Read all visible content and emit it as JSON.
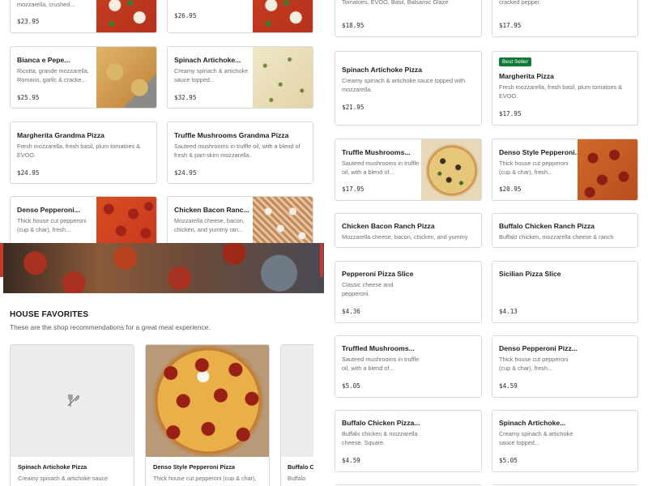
{
  "left_grid": [
    {
      "title": "",
      "desc": "mozzarella, crushed...",
      "price": "$23.95",
      "image": "pz-margherita"
    },
    {
      "title": "",
      "desc": "",
      "price": "$26.95",
      "image": "pz-margherita"
    },
    {
      "title": "Bianca e Pepe...",
      "desc": "Ricotta, grande mozzarella, Romano, garlic & cracke...",
      "price": "$25.95",
      "image": "pz-grandma"
    },
    {
      "title": "Spinach Artichoke...",
      "desc": "Creamy spinach & artichoke sauce topped...",
      "price": "$32.95",
      "image": "pz-white"
    },
    {
      "title": "Margherita Grandma Pizza",
      "desc": "Fresh mozzarella, fresh basil, plum tomatoes & EVOO.",
      "price": "$24.95"
    },
    {
      "title": "Truffle Mushrooms Grandma Pizza",
      "desc": "Sauteed mushrooms in truffle oil, with a blend of fresh & part-skim mozzarella.",
      "price": "$24.95"
    },
    {
      "title": "Denso Pepperoni...",
      "desc": "Thick house cut pepperoni (cup & char), fresh...",
      "price": "",
      "image": "pz-pepperoni"
    },
    {
      "title": "Chicken Bacon Ranc...",
      "desc": "Mozzarella cheese, bacon, chicken, and yummy ran...",
      "price": "",
      "image": "pz-ranch"
    }
  ],
  "house_favorites": {
    "heading": "HOUSE FAVORITES",
    "subtitle": "These are the shop recommendations for a great meal experience.",
    "items": [
      {
        "title": "Spinach Artichoke Pizza",
        "desc": "Creamy spinach & artichoke sauce",
        "icon": "utensils-icon"
      },
      {
        "title": "Denso Style Pepperoni Pizza",
        "desc": "Thick house cut pepperoni (cup & char),"
      },
      {
        "title": "Buffalo Ch",
        "desc": "Buffalo"
      }
    ]
  },
  "right_grid": {
    "top_left_desc": "Dollops of burrata, Pecorino Romano, basil, Tomatoes, EVOO, Basil, Balsamic Glaze",
    "top_left_price": "$18.95",
    "top_right_desc": "ricotta, grande mozzarella, Romano, garlic & cracked pepper.",
    "top_right_price": "$17.95",
    "items": [
      {
        "title": "Spinach Artichoke Pizza",
        "desc": "Creamy spinach & artichoke sauce topped with mozzarella.",
        "price": "$21.95"
      },
      {
        "badge": "Best Seller",
        "title": "Margherita Pizza",
        "desc": "Fresh mozzarella, fresh basil, plum tomatoes & EVOO.",
        "price": "$17.95"
      },
      {
        "title": "Truffle Mushrooms...",
        "desc": "Sauteed mushrooms in truffle oil, with a blend of...",
        "price": "$17.95",
        "image": "pz-mushroom"
      },
      {
        "title": "Denso Style Pepperoni...",
        "desc": "Thick house cut pepperoni (cup & char), fresh...",
        "price": "$20.95",
        "image": "pz-denso"
      },
      {
        "title": "Chicken Bacon Ranch Pizza",
        "desc": "Mozzarella cheese, bacon, chicken, and yummy",
        "price": ""
      },
      {
        "title": "Buffalo Chicken Ranch Pizza",
        "desc": "Buffalo chicken, mozzarella cheese & ranch",
        "price": ""
      },
      {
        "title": "Pepperoni Pizza Slice",
        "desc": "Classic cheese and pepperoni.",
        "price": "$4.36"
      },
      {
        "title": "Sicilian Pizza Slice",
        "desc": "",
        "price": "$4.13"
      },
      {
        "title": "Truffled Mushrooms...",
        "desc": "Sauteed mushrooms in truffle oil, with a blend of...",
        "price": "$5.05"
      },
      {
        "title": "Denso Pepperoni Pizz...",
        "desc": "Thick house cut pepperoni (cup & char), fresh...",
        "price": "$4.59"
      },
      {
        "title": "Buffalo Chicken Pizza...",
        "desc": "Buffalo chicken & mozzarella cheese. Square.",
        "price": "$4.59"
      },
      {
        "title": "Spinach Artichoke...",
        "desc": "Creamy spinach & artichoke sauce topped...",
        "price": "$5.05"
      }
    ]
  },
  "colors": {
    "badge": "#0f7a35",
    "border": "#d9d9d9",
    "banner_accent": "#c53a2b"
  }
}
